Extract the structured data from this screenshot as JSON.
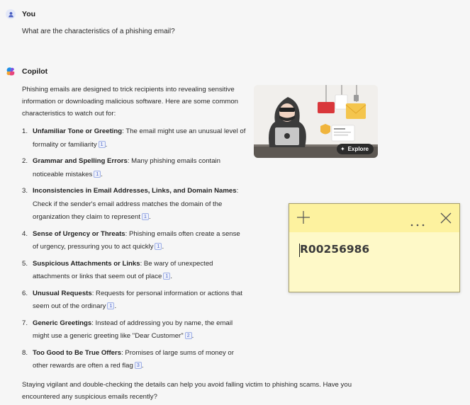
{
  "user": {
    "name": "You",
    "message": "What are the characteristics of a phishing email?"
  },
  "copilot": {
    "name": "Copilot",
    "intro": "Phishing emails are designed to trick recipients into revealing sensitive information or downloading malicious software. Here are some common characteristics to watch out for:",
    "items": [
      {
        "num": "1.",
        "title": "Unfamiliar Tone or Greeting",
        "text": ": The email might use an unusual level of formality or familiarity",
        "cite": "1",
        "end": "."
      },
      {
        "num": "2.",
        "title": "Grammar and Spelling Errors",
        "text": ": Many phishing emails contain noticeable mistakes",
        "cite": "1",
        "end": "."
      },
      {
        "num": "3.",
        "title": "Inconsistencies in Email Addresses, Links, and Domain Names",
        "text": ": Check if the sender's email address matches the domain of the organization they claim to represent",
        "cite": "1",
        "end": "."
      },
      {
        "num": "4.",
        "title": "Sense of Urgency or Threats",
        "text": ": Phishing emails often create a sense of urgency, pressuring you to act quickly",
        "cite": "1",
        "end": "."
      },
      {
        "num": "5.",
        "title": "Suspicious Attachments or Links",
        "text": ": Be wary of unexpected attachments or links that seem out of place",
        "cite": "1",
        "end": "."
      },
      {
        "num": "6.",
        "title": "Unusual Requests",
        "text": ": Requests for personal information or actions that seem out of the ordinary",
        "cite": "1",
        "end": "."
      },
      {
        "num": "7.",
        "title": "Generic Greetings",
        "text": ": Instead of addressing you by name, the email might use a generic greeting like \"Dear Customer\"",
        "cite": "2",
        "end": "."
      },
      {
        "num": "8.",
        "title": "Too Good to Be True Offers",
        "text": ": Promises of large sums of money or other rewards are often a red flag",
        "cite": "3",
        "end": "."
      }
    ],
    "outro": "Staying vigilant and double-checking the details can help you avoid falling victim to phishing scams. Have you encountered any suspicious emails recently?",
    "image_card": {
      "explore_label": "Explore"
    }
  },
  "sticky_note": {
    "text": "R00256986",
    "icons": [
      "plus-icon",
      "more-icon",
      "close-icon"
    ],
    "colors": {
      "bar": "#fdf29f",
      "body": "#fef9c8"
    }
  }
}
